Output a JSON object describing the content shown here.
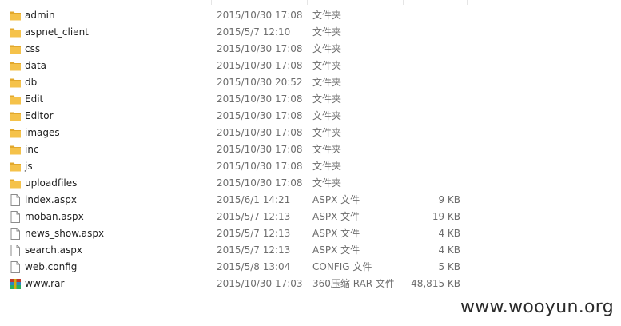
{
  "files": [
    {
      "name": "admin",
      "date": "2015/10/30 17:08",
      "type": "文件夹",
      "size": "",
      "icon": "folder-icon"
    },
    {
      "name": "aspnet_client",
      "date": "2015/5/7 12:10",
      "type": "文件夹",
      "size": "",
      "icon": "folder-icon"
    },
    {
      "name": "css",
      "date": "2015/10/30 17:08",
      "type": "文件夹",
      "size": "",
      "icon": "folder-icon"
    },
    {
      "name": "data",
      "date": "2015/10/30 17:08",
      "type": "文件夹",
      "size": "",
      "icon": "folder-icon"
    },
    {
      "name": "db",
      "date": "2015/10/30 20:52",
      "type": "文件夹",
      "size": "",
      "icon": "folder-icon"
    },
    {
      "name": "Edit",
      "date": "2015/10/30 17:08",
      "type": "文件夹",
      "size": "",
      "icon": "folder-icon"
    },
    {
      "name": "Editor",
      "date": "2015/10/30 17:08",
      "type": "文件夹",
      "size": "",
      "icon": "folder-icon"
    },
    {
      "name": "images",
      "date": "2015/10/30 17:08",
      "type": "文件夹",
      "size": "",
      "icon": "folder-icon"
    },
    {
      "name": "inc",
      "date": "2015/10/30 17:08",
      "type": "文件夹",
      "size": "",
      "icon": "folder-icon"
    },
    {
      "name": "js",
      "date": "2015/10/30 17:08",
      "type": "文件夹",
      "size": "",
      "icon": "folder-icon"
    },
    {
      "name": "uploadfiles",
      "date": "2015/10/30 17:08",
      "type": "文件夹",
      "size": "",
      "icon": "folder-icon"
    },
    {
      "name": "index.aspx",
      "date": "2015/6/1 14:21",
      "type": "ASPX 文件",
      "size": "9 KB",
      "icon": "file-icon"
    },
    {
      "name": "moban.aspx",
      "date": "2015/5/7 12:13",
      "type": "ASPX 文件",
      "size": "19 KB",
      "icon": "file-icon"
    },
    {
      "name": "news_show.aspx",
      "date": "2015/5/7 12:13",
      "type": "ASPX 文件",
      "size": "4 KB",
      "icon": "file-icon"
    },
    {
      "name": "search.aspx",
      "date": "2015/5/7 12:13",
      "type": "ASPX 文件",
      "size": "4 KB",
      "icon": "file-icon"
    },
    {
      "name": "web.config",
      "date": "2015/5/8 13:04",
      "type": "CONFIG 文件",
      "size": "5 KB",
      "icon": "file-icon"
    },
    {
      "name": "www.rar",
      "date": "2015/10/30 17:03",
      "type": "360压缩 RAR 文件",
      "size": "48,815 KB",
      "icon": "rar-archive-icon"
    }
  ],
  "watermark": "www.wooyun.org",
  "colors": {
    "folder": "#f5c24a",
    "folder_dark": "#e2a82c",
    "text": "#1e1e1e",
    "secondary_text": "#6d6d6d"
  }
}
